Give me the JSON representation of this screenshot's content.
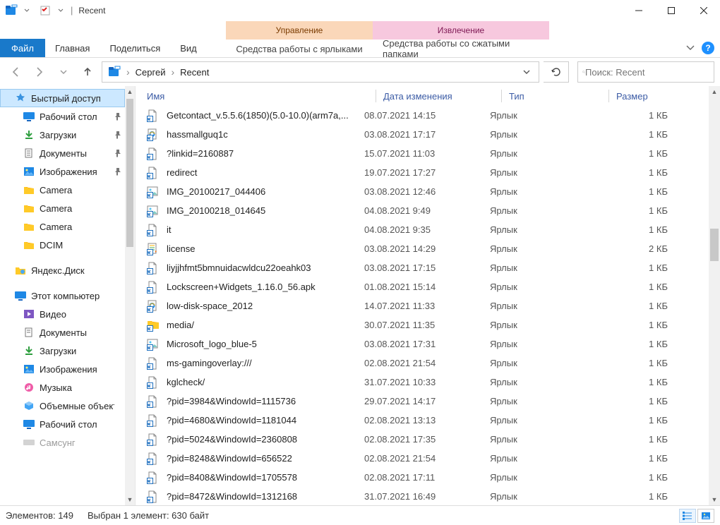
{
  "window": {
    "title": "Recent"
  },
  "context_tabs": {
    "ctx1": {
      "header": "Управление",
      "tab": "Средства работы с ярлыками"
    },
    "ctx2": {
      "header": "Извлечение",
      "tab": "Средства работы со сжатыми папками"
    }
  },
  "ribbon": {
    "file": "Файл",
    "home": "Главная",
    "share": "Поделиться",
    "view": "Вид"
  },
  "breadcrumb": {
    "seg1": "Сергей",
    "seg2": "Recent"
  },
  "search": {
    "placeholder": "Поиск: Recent"
  },
  "columns": {
    "name": "Имя",
    "date": "Дата изменения",
    "type": "Тип",
    "size": "Размер"
  },
  "sidebar": {
    "quick_access": "Быстрый доступ",
    "desktop": "Рабочий стол",
    "downloads": "Загрузки",
    "documents": "Документы",
    "pictures": "Изображения",
    "camera1": "Camera",
    "camera2": "Camera",
    "camera3": "Camera",
    "dcim": "DCIM",
    "yandex": "Яндекс.Диск",
    "thispc": "Этот компьютер",
    "videos": "Видео",
    "documents2": "Документы",
    "downloads2": "Загрузки",
    "pictures2": "Изображения",
    "music": "Музыка",
    "objects3d": "Объемные объекты",
    "desktop2": "Рабочий стол",
    "samsung": "Самсунг"
  },
  "files": [
    {
      "name": "Getcontact_v.5.5.6(1850)(5.0-10.0)(arm7a,...",
      "date": "08.07.2021 14:15",
      "type": "Ярлык",
      "size": "1 КБ",
      "icon": "doc"
    },
    {
      "name": "hassmallguq1c",
      "date": "03.08.2021 17:17",
      "type": "Ярлык",
      "size": "1 КБ",
      "icon": "ie"
    },
    {
      "name": "?linkid=2160887",
      "date": "15.07.2021 11:03",
      "type": "Ярлык",
      "size": "1 КБ",
      "icon": "doc"
    },
    {
      "name": "redirect",
      "date": "19.07.2021 17:27",
      "type": "Ярлык",
      "size": "1 КБ",
      "icon": "doc"
    },
    {
      "name": "IMG_20100217_044406",
      "date": "03.08.2021 12:46",
      "type": "Ярлык",
      "size": "1 КБ",
      "icon": "img"
    },
    {
      "name": "IMG_20100218_014645",
      "date": "04.08.2021 9:49",
      "type": "Ярлык",
      "size": "1 КБ",
      "icon": "img"
    },
    {
      "name": "it",
      "date": "04.08.2021 9:35",
      "type": "Ярлык",
      "size": "1 КБ",
      "icon": "doc"
    },
    {
      "name": "license",
      "date": "03.08.2021 14:29",
      "type": "Ярлык",
      "size": "2 КБ",
      "icon": "word"
    },
    {
      "name": "liyjjhfmt5bmnuidacwldcu22oeahk03",
      "date": "03.08.2021 17:15",
      "type": "Ярлык",
      "size": "1 КБ",
      "icon": "doc"
    },
    {
      "name": "Lockscreen+Widgets_1.16.0_56.apk",
      "date": "01.08.2021 15:14",
      "type": "Ярлык",
      "size": "1 КБ",
      "icon": "doc"
    },
    {
      "name": "low-disk-space_2012",
      "date": "14.07.2021 11:33",
      "type": "Ярлык",
      "size": "1 КБ",
      "icon": "ie"
    },
    {
      "name": "media/",
      "date": "30.07.2021 11:35",
      "type": "Ярлык",
      "size": "1 КБ",
      "icon": "folder"
    },
    {
      "name": "Microsoft_logo_blue-5",
      "date": "03.08.2021 17:31",
      "type": "Ярлык",
      "size": "1 КБ",
      "icon": "img"
    },
    {
      "name": "ms-gamingoverlay:///",
      "date": "02.08.2021 21:54",
      "type": "Ярлык",
      "size": "1 КБ",
      "icon": "doc"
    },
    {
      "name": "kglcheck/",
      "date": "31.07.2021 10:33",
      "type": "Ярлык",
      "size": "1 КБ",
      "icon": "doc"
    },
    {
      "name": "?pid=3984&WindowId=1115736",
      "date": "29.07.2021 14:17",
      "type": "Ярлык",
      "size": "1 КБ",
      "icon": "doc"
    },
    {
      "name": "?pid=4680&WindowId=1181044",
      "date": "02.08.2021 13:13",
      "type": "Ярлык",
      "size": "1 КБ",
      "icon": "doc"
    },
    {
      "name": "?pid=5024&WindowId=2360808",
      "date": "02.08.2021 17:35",
      "type": "Ярлык",
      "size": "1 КБ",
      "icon": "doc"
    },
    {
      "name": "?pid=8248&WindowId=656522",
      "date": "02.08.2021 21:54",
      "type": "Ярлык",
      "size": "1 КБ",
      "icon": "doc"
    },
    {
      "name": "?pid=8408&WindowId=1705578",
      "date": "02.08.2021 17:11",
      "type": "Ярлык",
      "size": "1 КБ",
      "icon": "doc"
    },
    {
      "name": "?pid=8472&WindowId=1312168",
      "date": "31.07.2021 16:49",
      "type": "Ярлык",
      "size": "1 КБ",
      "icon": "doc"
    }
  ],
  "status": {
    "count": "Элементов: 149",
    "selected": "Выбран 1 элемент: 630 байт"
  }
}
